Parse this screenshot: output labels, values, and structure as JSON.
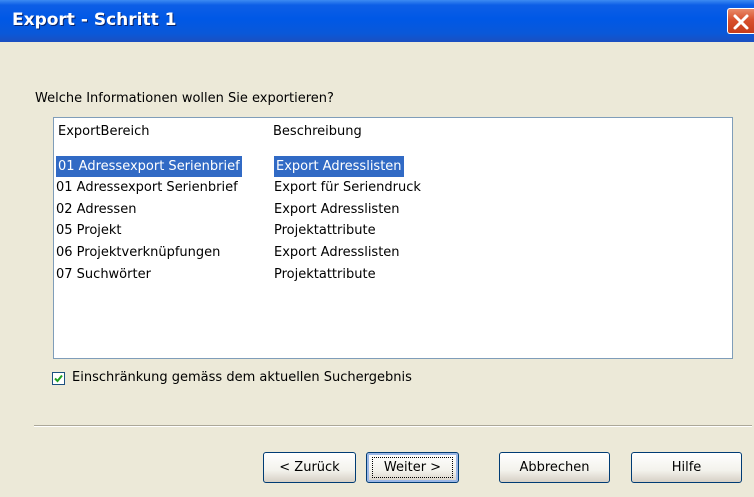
{
  "window": {
    "title": "Export - Schritt 1"
  },
  "prompt": "Welche Informationen wollen Sie exportieren?",
  "list": {
    "columns": [
      "ExportBereich",
      "Beschreibung"
    ],
    "rows": [
      {
        "bereich": "01 Adressexport Serienbrief",
        "beschreibung": "Export Adresslisten",
        "selected": true
      },
      {
        "bereich": "01 Adressexport Serienbrief",
        "beschreibung": "Export für Seriendruck"
      },
      {
        "bereich": "02 Adressen",
        "beschreibung": "Export Adresslisten"
      },
      {
        "bereich": "05 Projekt",
        "beschreibung": "Projektattribute"
      },
      {
        "bereich": "06 Projektverknüpfungen",
        "beschreibung": "Export Adresslisten"
      },
      {
        "bereich": "07 Suchwörter",
        "beschreibung": "Projektattribute"
      }
    ]
  },
  "checkbox": {
    "label": "Einschränkung gemäss dem aktuellen Suchergebnis",
    "checked": true
  },
  "buttons": {
    "back": "< Zurück",
    "next": "Weiter >",
    "cancel": "Abbrechen",
    "help": "Hilfe"
  },
  "colors": {
    "title_bar": "#0058e6",
    "selection": "#316ac5",
    "dialog_bg": "#ece9d8"
  },
  "icons": {
    "close": "close-icon",
    "check": "check-icon"
  }
}
